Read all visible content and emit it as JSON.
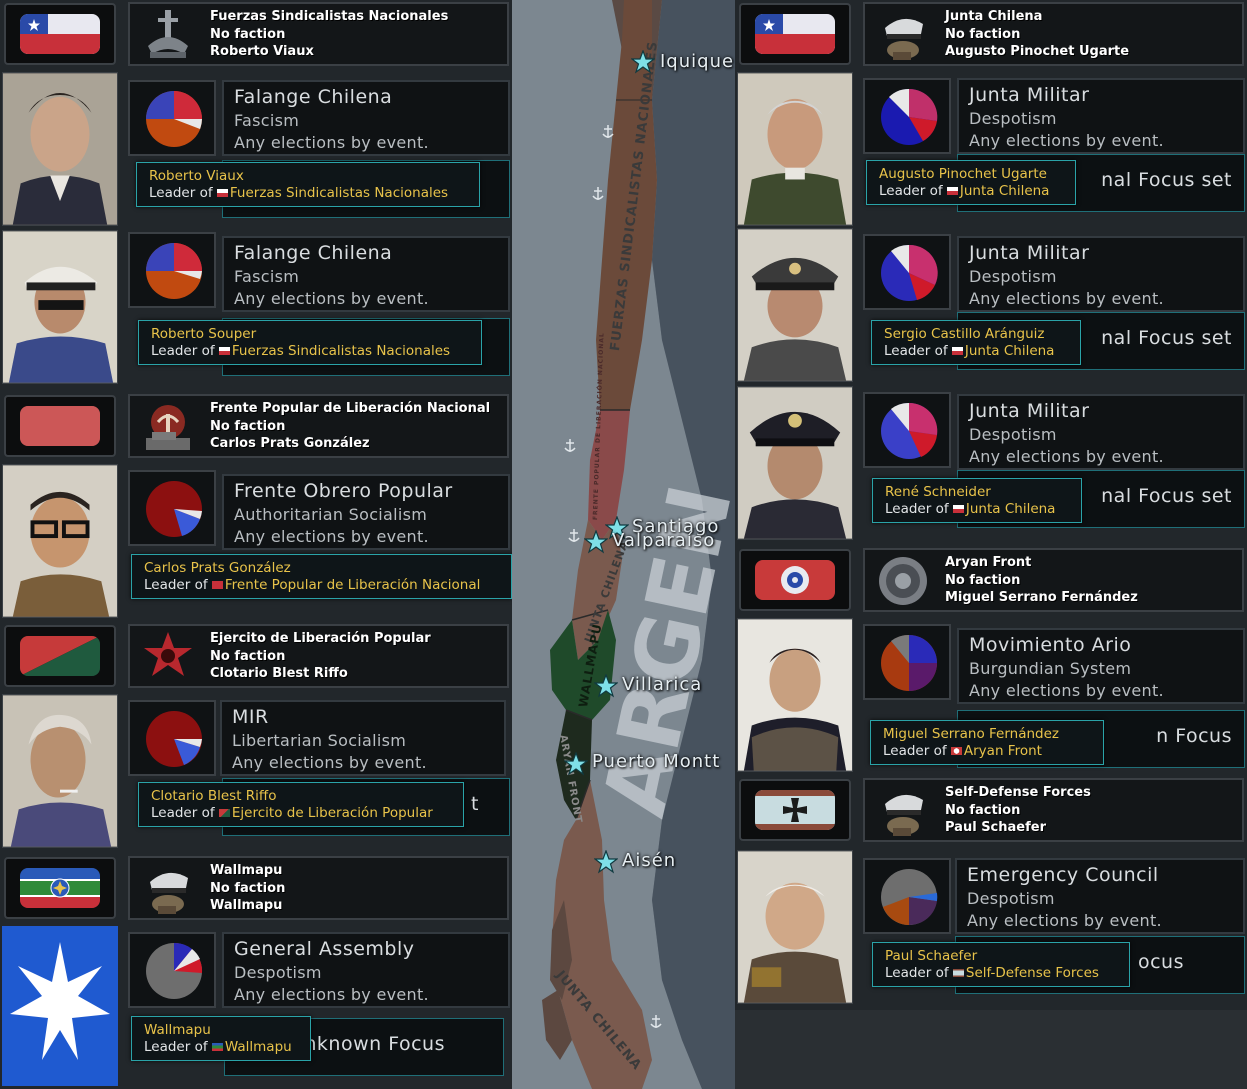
{
  "countries_left": [
    {
      "id": "fsn",
      "name": "Fuerzas Sindicalistas Nacionales",
      "faction": "No faction",
      "leader": "Roberto Viaux",
      "parties": [
        {
          "party": "Falange Chilena",
          "ideology": "Fascism",
          "elections": "Any elections by event.",
          "tooltip_name": "Roberto Viaux",
          "tooltip_leader_prefix": "Leader of",
          "tooltip_faction": "Fuerzas Sindicalistas Nacionales"
        },
        {
          "party": "Falange Chilena",
          "ideology": "Fascism",
          "elections": "Any elections by event.",
          "tooltip_name": "Roberto Souper",
          "tooltip_leader_prefix": "Leader of",
          "tooltip_faction": "Fuerzas Sindicalistas Nacionales"
        }
      ]
    },
    {
      "id": "fpln",
      "name": "Frente Popular de Liberación Nacional",
      "faction": "No faction",
      "leader": "Carlos Prats González",
      "parties": [
        {
          "party": "Frente Obrero Popular",
          "ideology": "Authoritarian Socialism",
          "elections": "Any elections by event.",
          "tooltip_name": "Carlos Prats González",
          "tooltip_leader_prefix": "Leader of",
          "tooltip_faction": "Frente Popular de Liberación Nacional"
        }
      ]
    },
    {
      "id": "elp",
      "name": "Ejercito de Liberación Popular",
      "faction": "No faction",
      "leader": "Clotario Blest Riffo",
      "parties": [
        {
          "party": "MIR",
          "ideology": "Libertarian Socialism",
          "elections": "Any elections by event.",
          "focus_partial": "t",
          "tooltip_name": "Clotario Blest Riffo",
          "tooltip_leader_prefix": "Leader of",
          "tooltip_faction": "Ejercito de Liberación Popular"
        }
      ]
    },
    {
      "id": "wallmapu",
      "name": "Wallmapu",
      "faction": "No faction",
      "leader": "Wallmapu",
      "parties": [
        {
          "party": "General Assembly",
          "ideology": "Despotism",
          "elections": "Any elections by event.",
          "focus_partial": "nknown Focus",
          "tooltip_name": "Wallmapu",
          "tooltip_leader_prefix": "Leader of",
          "tooltip_faction": "Wallmapu"
        }
      ]
    }
  ],
  "countries_right": [
    {
      "id": "junta",
      "name": "Junta Chilena",
      "faction": "No faction",
      "leader": "Augusto Pinochet Ugarte",
      "parties": [
        {
          "party": "Junta Militar",
          "ideology": "Despotism",
          "elections": "Any elections by event.",
          "focus_partial": "nal Focus set",
          "tooltip_name": "Augusto Pinochet Ugarte",
          "tooltip_leader_prefix": "Leader of",
          "tooltip_faction": "Junta Chilena"
        },
        {
          "party": "Junta Militar",
          "ideology": "Despotism",
          "elections": "Any elections by event.",
          "focus_partial": "nal Focus set",
          "tooltip_name": "Sergio Castillo Aránguiz",
          "tooltip_leader_prefix": "Leader of",
          "tooltip_faction": "Junta Chilena"
        },
        {
          "party": "Junta Militar",
          "ideology": "Despotism",
          "elections": "Any elections by event.",
          "focus_partial": "nal Focus set",
          "tooltip_name": "René Schneider",
          "tooltip_leader_prefix": "Leader of",
          "tooltip_faction": "Junta Chilena"
        }
      ]
    },
    {
      "id": "aryan",
      "name": "Aryan Front",
      "faction": "No faction",
      "leader": "Miguel Serrano Fernández",
      "parties": [
        {
          "party": "Movimiento Ario",
          "ideology": "Burgundian System",
          "elections": "Any elections by event.",
          "focus_partial": "n Focus",
          "tooltip_name": "Miguel Serrano Fernández",
          "tooltip_leader_prefix": "Leader of",
          "tooltip_faction": "Aryan Front"
        }
      ]
    },
    {
      "id": "sdf",
      "name": "Self-Defense Forces",
      "faction": "No faction",
      "leader": "Paul Schaefer",
      "parties": [
        {
          "party": "Emergency Council",
          "ideology": "Despotism",
          "elections": "Any elections by event.",
          "focus_partial": "ocus",
          "tooltip_name": "Paul Schaefer",
          "tooltip_leader_prefix": "Leader of",
          "tooltip_faction": "Self-Defense Forces"
        }
      ]
    }
  ],
  "map": {
    "cities": [
      "Iquique",
      "Santiago",
      "Valparaíso",
      "Villarica",
      "Puerto Montt",
      "Aisén"
    ],
    "region_labels": [
      "FUERZAS SINDICALISTAS NACIONALES",
      "FRENTE POPULAR DE LIBERACIÓN NACIONAL",
      "JUNTA CHILENA",
      "WALLMAPU",
      "ARYAN FRONT",
      "JUNTA CHILENA"
    ],
    "country_label": "ARGEN"
  },
  "colors": {
    "fsn": "#6b4a3a",
    "fpln": "#8a4a4a",
    "junta": "#7a5a4e",
    "wallmapu": "#1f4a2a",
    "aryan": "#1e2a1e",
    "sea": "#7c8790",
    "tooltip_border": "#2aa3a8",
    "tooltip_gold": "#e8c34a"
  },
  "icons": [
    "chile-flag-icon",
    "fsn-emblem-icon",
    "fpln-emblem-icon",
    "elp-emblem-icon",
    "military-cap-icon",
    "aryan-emblem-icon",
    "iron-cross-flag-icon",
    "capital-star-icon",
    "port-anchor-icon"
  ]
}
